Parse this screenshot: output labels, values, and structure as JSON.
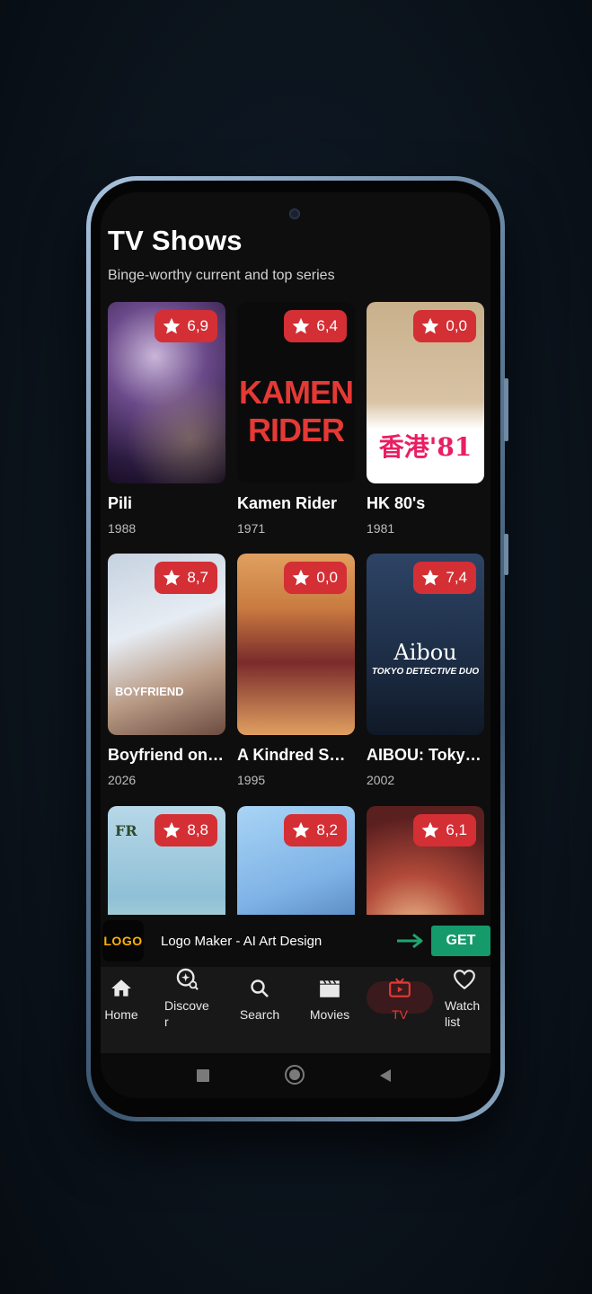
{
  "page": {
    "title": "TV Shows",
    "subtitle": "Binge-worthy current and top series"
  },
  "shows": [
    {
      "title": "Pili",
      "year": "1988",
      "rating": "6,9",
      "colors": [
        "#2a1a3e",
        "#6b4a8a",
        "#c9b6d9"
      ]
    },
    {
      "title": "Kamen Rider",
      "year": "1971",
      "rating": "6,4",
      "colors": [
        "#0b0b0b",
        "#1a1a1a",
        "#e53935"
      ]
    },
    {
      "title": "HK 80's",
      "year": "1981",
      "rating": "0,0",
      "colors": [
        "#c9b08c",
        "#ffffff",
        "#e91e63"
      ]
    },
    {
      "title": "Boyfriend on Demand",
      "year": "2026",
      "rating": "8,7",
      "colors": [
        "#c6d2e0",
        "#f0f0f0",
        "#6d4c41"
      ]
    },
    {
      "title": "A Kindred Spirit",
      "year": "1995",
      "rating": "0,0",
      "colors": [
        "#e0a060",
        "#7a2b2b",
        "#f5d7b0"
      ]
    },
    {
      "title": "AIBOU: Tokyo Detective Duo",
      "year": "2002",
      "rating": "7,4",
      "colors": [
        "#1c2c44",
        "#2e4466",
        "#9fb3cc"
      ]
    },
    {
      "title": "",
      "year": "",
      "rating": "8,8",
      "colors": [
        "#b7d8e8",
        "#6fa9c6",
        "#e3f0d0"
      ]
    },
    {
      "title": "",
      "year": "",
      "rating": "8,2",
      "colors": [
        "#7fb3e6",
        "#a8d4f5",
        "#2f5b9a"
      ]
    },
    {
      "title": "",
      "year": "",
      "rating": "6,1",
      "colors": [
        "#5a1f1f",
        "#b24a3a",
        "#f0c090"
      ]
    }
  ],
  "poster_texts": {
    "kamen_line1": "KAMEN",
    "kamen_line2": "RIDER",
    "hk": "香港'81",
    "aibou": "Aibou",
    "aibou_sub": "TOKYO DETECTIVE DUO",
    "boyfriend": "BOYFRIEND",
    "fr": "FR"
  },
  "ad": {
    "logo_text": "LOGO",
    "title": "Logo Maker - AI Art Design",
    "cta": "GET"
  },
  "nav": [
    {
      "label": "Home",
      "icon": "home-icon"
    },
    {
      "label": "Discover",
      "icon": "discover-icon"
    },
    {
      "label": "Search",
      "icon": "search-icon"
    },
    {
      "label": "Movies",
      "icon": "movies-icon"
    },
    {
      "label": "TV",
      "icon": "tv-icon",
      "active": true
    },
    {
      "label": "Watch list",
      "icon": "heart-icon"
    }
  ],
  "colors": {
    "accent": "#d32f35",
    "ad_cta": "#159a6c",
    "arrow": "#1ea672"
  }
}
